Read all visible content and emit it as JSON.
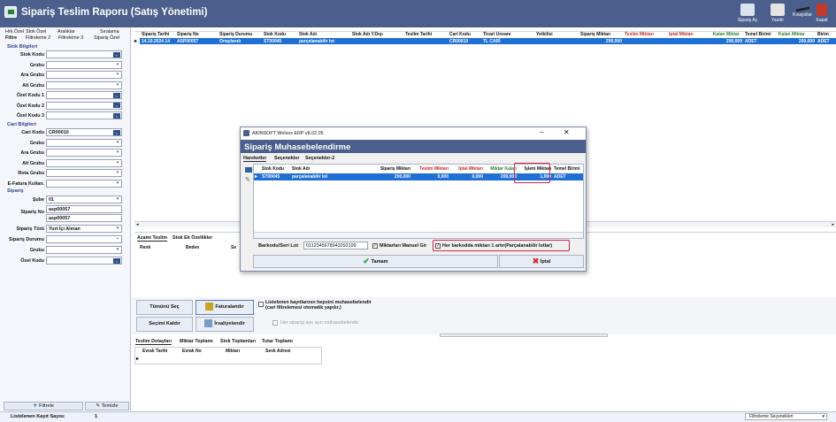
{
  "app": {
    "title": "Sipariş Teslim Raporu (Satış Yönetimi)",
    "toolbar": [
      {
        "label": "Sipariş Aç",
        "icon": "order-open-icon"
      },
      {
        "label": "Yazdır",
        "icon": "printer-icon"
      },
      {
        "label": "Kısayollar",
        "icon": "shortcuts-icon"
      },
      {
        "label": "Kapat",
        "icon": "close-door-icon"
      }
    ]
  },
  "left": {
    "tabs": [
      "Hrk.Özel",
      "Stok Özel",
      "Aralıklar",
      "Sıralama",
      "Filtre",
      "Filtreleme 2",
      "Filtreleme 3",
      "Sipariş Özel"
    ],
    "stok_section": "Stok Bilgileri",
    "stok_fields": [
      {
        "label": "Stok Kodu",
        "value": "",
        "btn": "blue"
      },
      {
        "label": "Grubu",
        "value": "",
        "btn": "dd"
      },
      {
        "label": "Ara Grubu",
        "value": "",
        "btn": "dd"
      },
      {
        "label": "Alt Grubu",
        "value": "",
        "btn": "dd"
      },
      {
        "label": "Özel Kodu 1",
        "value": "",
        "btn": "blue"
      },
      {
        "label": "Özel Kodu 2",
        "value": "",
        "btn": "blue"
      },
      {
        "label": "Özel Kodu 3",
        "value": "",
        "btn": "blue"
      }
    ],
    "cari_section": "Cari Bilgileri",
    "cari_fields": [
      {
        "label": "Cari Kodu",
        "value": "CR00010",
        "btn": "blue"
      },
      {
        "label": "Grubu",
        "value": "",
        "btn": "dd"
      },
      {
        "label": "Ara Grubu",
        "value": "",
        "btn": "dd"
      },
      {
        "label": "Alt Grubu",
        "value": "",
        "btn": "dd"
      },
      {
        "label": "Rota Grubu",
        "value": "",
        "btn": "dd"
      },
      {
        "label": "E-Fatura Kullan.",
        "value": "",
        "btn": "dd"
      }
    ],
    "siparis_section": "Sipariş",
    "sube_label": "Şube",
    "sube_value": "01",
    "siparis_no_label": "Sipariş No",
    "siparis_no_1": "asp00057",
    "siparis_no_2": "asp00057",
    "siparis_turu_label": "Sipariş Türü",
    "siparis_turu_value": "Yurt İçi Alınan",
    "siparis_durumu_label": "Sipariş Durumu",
    "siparis_durumu_value": "",
    "grubu_label": "Grubu",
    "ozel_kodu_label": "Özel Kodu",
    "filtrele": "Filtrele",
    "temizle": "Temizle"
  },
  "grid": {
    "columns": [
      {
        "label": "Sipariş Tarihi",
        "color": "#111"
      },
      {
        "label": "Sipariş No",
        "color": "#111"
      },
      {
        "label": "Sipariş Durumu",
        "color": "#111"
      },
      {
        "label": "Stok Kodu",
        "color": "#111"
      },
      {
        "label": "Stok Adı",
        "color": "#111"
      },
      {
        "label": "Stok Adı Y.Dışı",
        "color": "#111"
      },
      {
        "label": "Teslim Tarihi",
        "color": "#111"
      },
      {
        "label": "Cari Kodu",
        "color": "#111"
      },
      {
        "label": "Ticari Unvanı",
        "color": "#111"
      },
      {
        "label": "Yetkilisi",
        "color": "#111"
      },
      {
        "label": "Sipariş Miktarı",
        "color": "#111"
      },
      {
        "label": "Teslim Miktarı",
        "color": "#c62828"
      },
      {
        "label": "İptal Miktarı",
        "color": "#c62828"
      },
      {
        "label": "Kalan Miktar",
        "color": "#2e7d32"
      },
      {
        "label": "Temel Birimi",
        "color": "#111"
      },
      {
        "label": "Kalan Miktar",
        "color": "#2e7d32"
      },
      {
        "label": "Birim",
        "color": "#111"
      }
    ],
    "row": [
      "14.10.2024 14",
      "ASP00057",
      "Onaylandı",
      "ST00045",
      "parçalanabilir lot",
      "",
      "",
      "CR00010",
      "TL CARİ",
      "",
      "200,000",
      "",
      "",
      "200,000",
      "ADET",
      "200,000",
      "ADET"
    ]
  },
  "lower": {
    "tabs": [
      "Azami Teslim",
      "Stok Ek Özellikler"
    ],
    "cols": [
      "Renk",
      "Beden",
      "Se"
    ],
    "select_all": "Tümünü Seç",
    "deselect": "Seçimi Kaldır",
    "invoice": "Faturalandır",
    "dispatch": "İrsaliyelendir",
    "chk1": "Listelenen kayıtlarının hepsini muhasebelendir (cari filtrelemesi otomatik yapılır.)",
    "chk2": "Her siparişi ayrı ayrı muhasebelendir."
  },
  "bottom": {
    "tabs": [
      "Teslim Detayları",
      "Miktar Toplamı",
      "Stok Toplamları",
      "Tutar Toplamı"
    ],
    "cols": [
      "Evrak Tarihi",
      "Evrak No",
      "Miktarı",
      "Sevk Adresi"
    ]
  },
  "status": {
    "label": "Listelenen Kayıt Sayısı",
    "count": "1",
    "filter_options": "Filtreleme Seçenekleri"
  },
  "dialog": {
    "window_title": "AKINSOFT Wolvox ERP v8.02.05",
    "header": "Sipariş Muhasebelendirme",
    "tabs": [
      "Hareketler",
      "Seçenekler",
      "Seçenekler-2"
    ],
    "columns": [
      {
        "label": "Stok Kodu",
        "color": "#111"
      },
      {
        "label": "Stok Adı",
        "color": "#111"
      },
      {
        "label": "Sipariş Miktarı",
        "color": "#111"
      },
      {
        "label": "Teslim Miktarı",
        "color": "#c62828"
      },
      {
        "label": "İptal Miktarı",
        "color": "#c62828"
      },
      {
        "label": "Miktar Kalan",
        "color": "#2e7d32"
      },
      {
        "label": "İşlem Miktarı",
        "color": "#111"
      },
      {
        "label": "Temel Birimi",
        "color": "#111"
      }
    ],
    "row": [
      "ST00045",
      "parçalanabilir lot",
      "200,000",
      "0,000",
      "0,000",
      "200,000",
      "1,000",
      "ADET"
    ],
    "barcode_label": "Barkodu/Seri Lot",
    "barcode_value": "0112345678943292199",
    "manual_label": "Miktarları Manuel Gir",
    "perbarcode_label": "Her barkodda miktarı 1 artır(Parçalanabilir lotlar)",
    "ok": "Tamam",
    "cancel": "İptal"
  }
}
